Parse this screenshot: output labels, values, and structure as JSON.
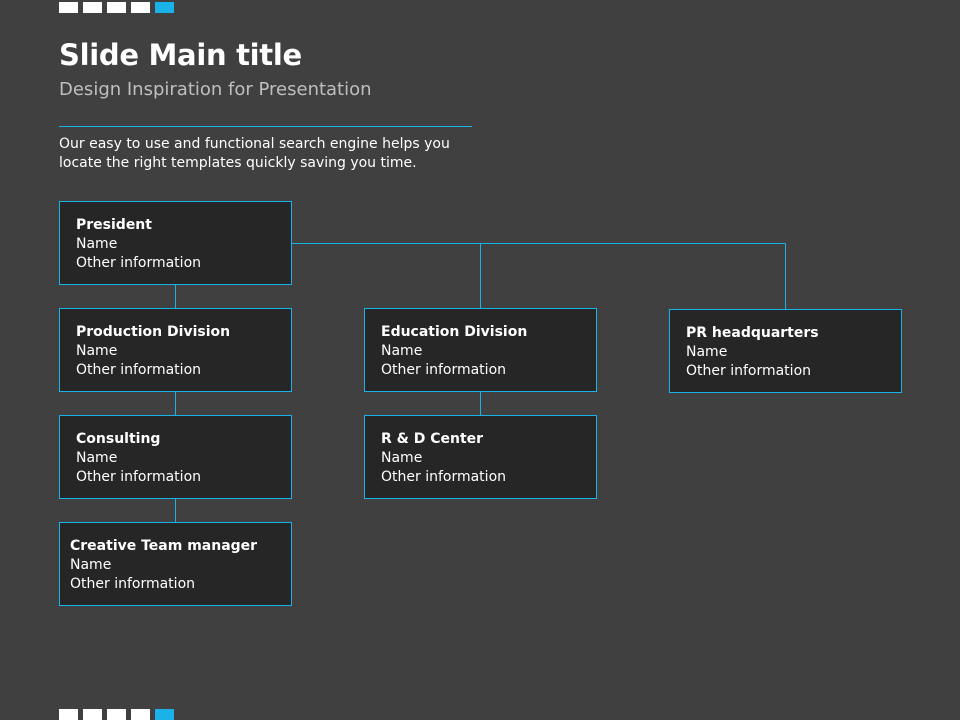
{
  "header": {
    "title": "Slide Main title",
    "subtitle": "Design Inspiration for Presentation",
    "description": "Our easy to use and functional search engine helps you locate the right templates quickly saving you time."
  },
  "colors": {
    "background": "#404040",
    "accent": "#1ab2e8",
    "box_fill": "#262626"
  },
  "org_chart": {
    "president": {
      "role": "President",
      "name": "Name",
      "info": "Other information"
    },
    "production": {
      "role": "Production Division",
      "name": "Name",
      "info": "Other information"
    },
    "consulting": {
      "role": "Consulting",
      "name": "Name",
      "info": "Other information"
    },
    "creative": {
      "role": "Creative Team manager",
      "name": "Name",
      "info": "Other information"
    },
    "education": {
      "role": "Education Division",
      "name": "Name",
      "info": "Other information"
    },
    "rnd": {
      "role": "R & D Center",
      "name": "Name",
      "info": "Other information"
    },
    "pr": {
      "role": "PR headquarters",
      "name": "Name",
      "info": "Other information"
    }
  }
}
